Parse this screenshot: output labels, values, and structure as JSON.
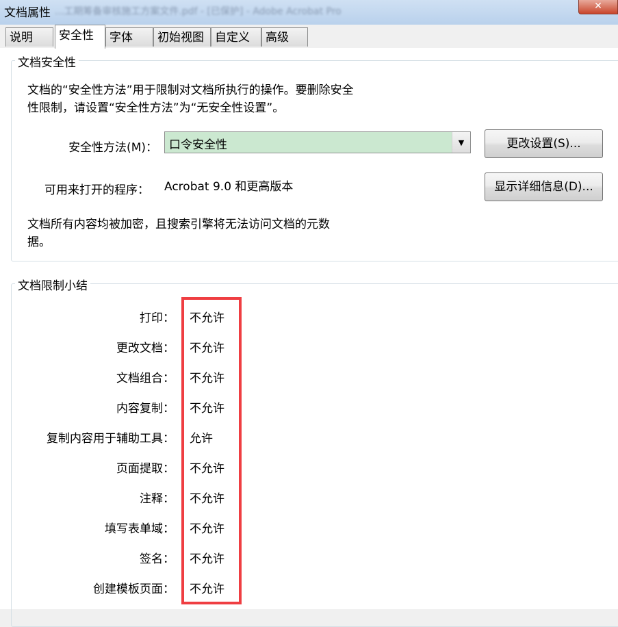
{
  "window": {
    "title": "文档属性",
    "background_title": "...工期筹备审核施工方案文件.pdf - [已保护] - Adobe Acrobat Pro",
    "close_glyph": "✕"
  },
  "tabs": [
    {
      "label": "说明"
    },
    {
      "label": "安全性"
    },
    {
      "label": "字体"
    },
    {
      "label": "初始视图"
    },
    {
      "label": "自定义"
    },
    {
      "label": "高级"
    }
  ],
  "security_group": {
    "title": "文档安全性",
    "description_line1": "文档的“安全性方法”用于限制对文档所执行的操作。要删除安全",
    "description_line2": "性限制，请设置“安全性方法”为“无安全性设置”。",
    "method_label": "安全性方法(M)：",
    "method_value": "口令安全性",
    "change_settings_button": "更改设置(S)...",
    "openable_label": "可用来打开的程序：",
    "openable_value": "Acrobat 9.0 和更高版本",
    "show_details_button": "显示详细信息(D)...",
    "encryption_note_line1": "文档所有内容均被加密，且搜索引擎将无法访问文档的元数",
    "encryption_note_line2": "据。"
  },
  "restrictions_group": {
    "title": "文档限制小结",
    "rows": [
      {
        "label": "打印：",
        "value": "不允许"
      },
      {
        "label": "更改文档：",
        "value": "不允许"
      },
      {
        "label": "文档组合：",
        "value": "不允许"
      },
      {
        "label": "内容复制：",
        "value": "不允许"
      },
      {
        "label": "复制内容用于辅助工具：",
        "value": "允许"
      },
      {
        "label": "页面提取：",
        "value": "不允许"
      },
      {
        "label": "注释：",
        "value": "不允许"
      },
      {
        "label": "填写表单域：",
        "value": "不允许"
      },
      {
        "label": "签名：",
        "value": "不允许"
      },
      {
        "label": "创建模板页面：",
        "value": "不允许"
      }
    ]
  },
  "colors": {
    "select_background": "#cbe8d0",
    "highlight_border": "#ef3e42"
  }
}
